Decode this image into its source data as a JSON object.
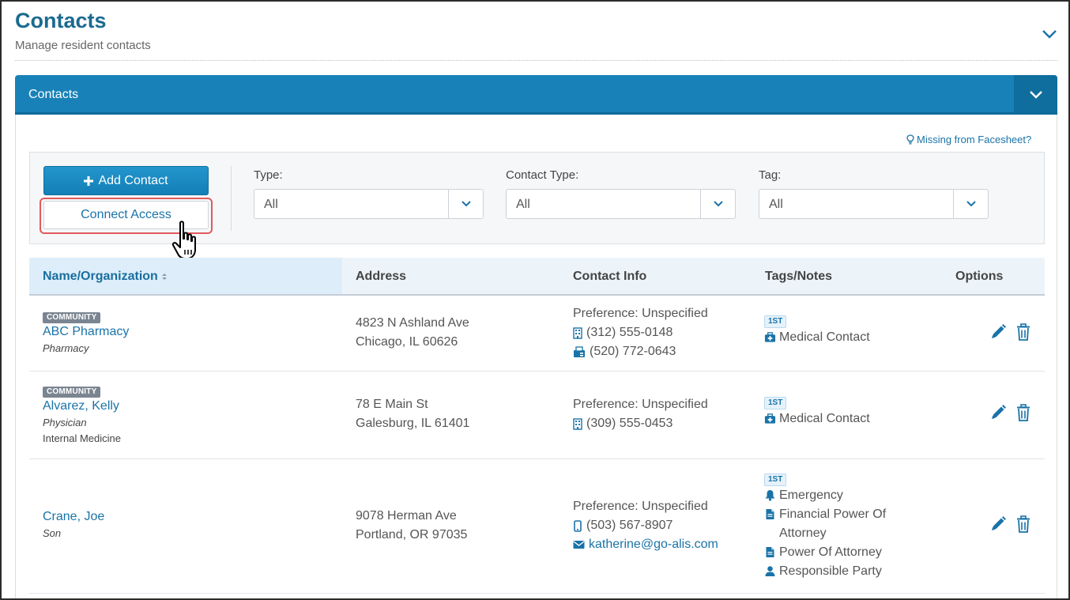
{
  "header": {
    "title": "Contacts",
    "subtitle": "Manage resident contacts"
  },
  "panel": {
    "title": "Contacts",
    "missing_link": "Missing from Facesheet?"
  },
  "toolbar": {
    "add_label": "Add Contact",
    "connect_label": "Connect Access"
  },
  "filters": [
    {
      "label": "Type:",
      "value": "All"
    },
    {
      "label": "Contact Type:",
      "value": "All"
    },
    {
      "label": "Tag:",
      "value": "All"
    }
  ],
  "table": {
    "columns": [
      "Name/Organization",
      "Address",
      "Contact Info",
      "Tags/Notes",
      "Options"
    ],
    "rows": [
      {
        "badge": "COMMUNITY",
        "name": "ABC Pharmacy",
        "role": "Pharmacy",
        "specialty": "",
        "address1": "4823 N Ashland Ave",
        "address2": "Chicago, IL 60626",
        "preference": "Preference: Unspecified",
        "phone": "(312) 555-0148",
        "phone_icon": "building-icon",
        "fax": "(520) 772-0643",
        "email": "",
        "tag_badge": "1ST",
        "tags": [
          "Medical Contact"
        ]
      },
      {
        "badge": "COMMUNITY",
        "name": "Alvarez, Kelly",
        "role": "Physician",
        "specialty": "Internal Medicine",
        "address1": "78 E Main St",
        "address2": "Galesburg, IL 61401",
        "preference": "Preference: Unspecified",
        "phone": "(309) 555-0453",
        "phone_icon": "building-icon",
        "fax": "",
        "email": "",
        "tag_badge": "1ST",
        "tags": [
          "Medical Contact"
        ]
      },
      {
        "badge": "",
        "name": "Crane, Joe",
        "role": "Son",
        "specialty": "",
        "address1": "9078 Herman Ave",
        "address2": "Portland, OR 97035",
        "preference": "Preference: Unspecified",
        "phone": "(503) 567-8907",
        "phone_icon": "mobile-icon",
        "fax": "",
        "email": "katherine@go-alis.com",
        "tag_badge": "1ST",
        "tags": [
          "Emergency",
          "Financial Power Of Attorney",
          "Power Of Attorney",
          "Responsible Party"
        ]
      }
    ]
  },
  "colors": {
    "accent": "#1882b8",
    "link": "#1a73a8",
    "highlight": "#e05a5f"
  }
}
